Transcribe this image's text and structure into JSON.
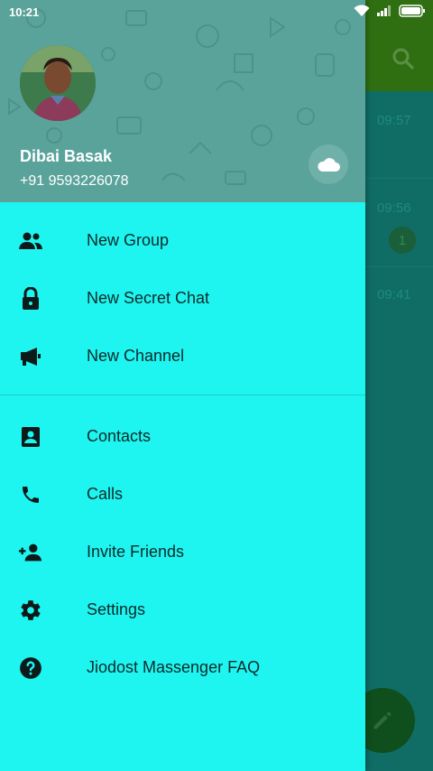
{
  "status_bar": {
    "time": "10:21",
    "icons": [
      "wifi-icon",
      "signal-icon",
      "battery-icon"
    ]
  },
  "drawer": {
    "user_name": "Dibai Basak",
    "user_phone": "+91 9593226078",
    "menu_group_1": [
      {
        "label": "New Group",
        "icon": "group-icon"
      },
      {
        "label": "New Secret Chat",
        "icon": "lock-icon"
      },
      {
        "label": "New Channel",
        "icon": "megaphone-icon"
      }
    ],
    "menu_group_2": [
      {
        "label": "Contacts",
        "icon": "contacts-icon"
      },
      {
        "label": "Calls",
        "icon": "phone-icon"
      },
      {
        "label": "Invite Friends",
        "icon": "add-person-icon"
      },
      {
        "label": "Settings",
        "icon": "gear-icon"
      },
      {
        "label": "Jiodost Massenger FAQ",
        "icon": "help-icon"
      }
    ]
  },
  "background_list": {
    "times": [
      "09:57",
      "09:56",
      "09:41"
    ],
    "unread_badge": "1"
  },
  "colors": {
    "drawer_bg": "#1ff5f0",
    "header_bg": "#5aa39b",
    "toolbar_bg": "#2f6f12",
    "list_bg": "#0f6d66"
  }
}
